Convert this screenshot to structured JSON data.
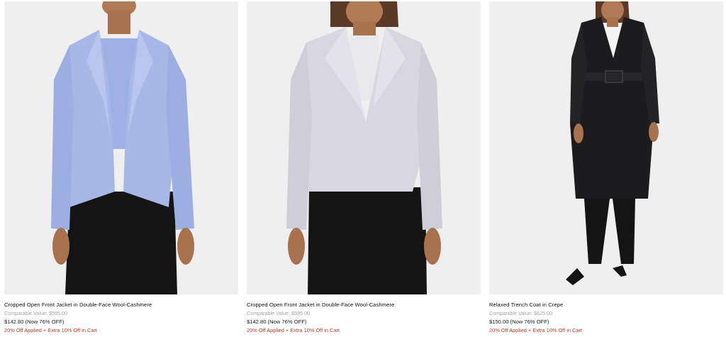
{
  "colors": {
    "photo_bg": "#efefef",
    "promo": "#c0392b",
    "compare": "#a3a3a3",
    "jacket_blue": "#a7b7e6",
    "jacket_grey": "#d8d6de",
    "coat_black": "#1c1c1e",
    "trousers": "#141414",
    "skin": "#b07a55"
  },
  "products": [
    {
      "name": "Cropped Open Front Jacket in Double-Face Wool-Cashmere",
      "compare": "Comparable Value: $595.00",
      "price": "$142.80 (Now 76% OFF)",
      "promo": "20% Off Applied + Extra 10% Off in Cart"
    },
    {
      "name": "Cropped Open Front Jacket in Double-Face Wool-Cashmere",
      "compare": "Comparable Value: $595.00",
      "price": "$142.80 (Now 76% OFF)",
      "promo": "20% Off Applied + Extra 10% Off in Cart"
    },
    {
      "name": "Relaxed Trench Coat in Crepe",
      "compare": "Comparable Value: $625.00",
      "price": "$150.00 (Now 76% OFF)",
      "promo": "20% Off Applied + Extra 10% Off in Cart"
    }
  ]
}
